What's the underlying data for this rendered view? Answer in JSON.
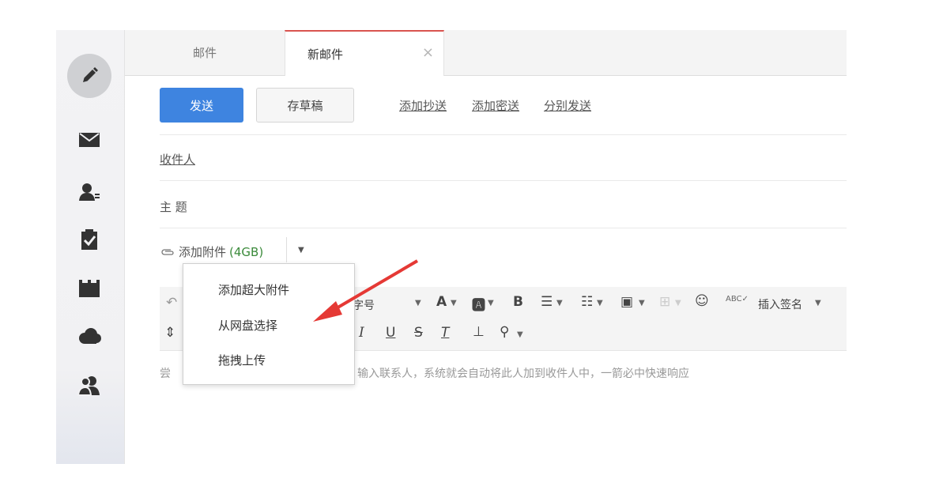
{
  "tabs": {
    "mail": "邮件",
    "new_mail": "新邮件",
    "close_glyph": "×"
  },
  "toolbar": {
    "send_label": "发送",
    "save_draft_label": "存草稿",
    "add_cc_label": "添加抄送",
    "add_bcc_label": "添加密送",
    "separate_send_label": "分别发送"
  },
  "form": {
    "recipient_label": "收件人",
    "subject_label": "主 题"
  },
  "attachment": {
    "label": "添加附件",
    "size": "(4GB)"
  },
  "attach_menu": {
    "items": [
      "添加超大附件",
      "从网盘选择",
      "拖拽上传"
    ]
  },
  "editor_toolbar": {
    "font_size_label": "字号",
    "insert_signature_label": "插入签名"
  },
  "editor": {
    "placeholder_fragment": "输入联系人，系统就会自动将此人加到收件人中，一箭必中快速响应",
    "placeholder_start": "尝"
  },
  "colors": {
    "send_button": "#3e84e0",
    "active_tab_border": "#d9534f",
    "annotation_arrow": "#e53935",
    "attachment_size": "#3a8a3a"
  }
}
